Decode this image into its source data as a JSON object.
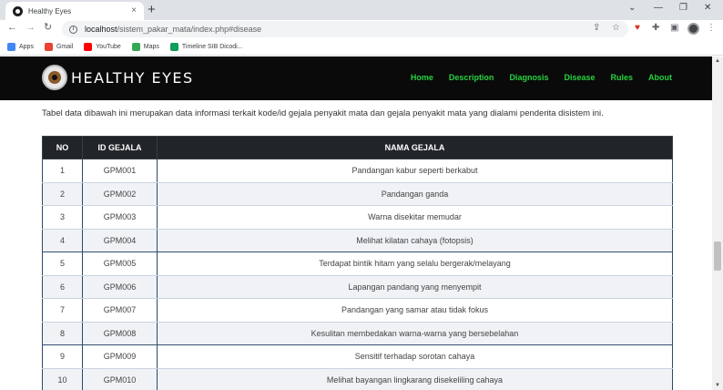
{
  "browser": {
    "tab_title": "Healthy Eyes",
    "tab_close": "×",
    "new_tab": "+",
    "window_controls": [
      "⌄",
      "—",
      "❐",
      "✕"
    ],
    "url_host": "localhost",
    "url_path": "/sistem_pakar_mata/index.php#disease",
    "bookmarks": [
      {
        "label": "Apps",
        "icon": "apps-grid-icon",
        "color": "#4285f4"
      },
      {
        "label": "Gmail",
        "icon": "gmail-icon",
        "color": "#ea4335"
      },
      {
        "label": "YouTube",
        "icon": "youtube-icon",
        "color": "#ff0000"
      },
      {
        "label": "Maps",
        "icon": "maps-pin-icon",
        "color": "#34a853"
      },
      {
        "label": "Timeline SIB Dicodi...",
        "icon": "plus-square-icon",
        "color": "#0f9d58"
      }
    ]
  },
  "navbar": {
    "brand": "HEALTHY EYES",
    "links": [
      "Home",
      "Description",
      "Diagnosis",
      "Disease",
      "Rules",
      "About"
    ],
    "link_color": "#27d23e"
  },
  "intro_text": "Tabel data dibawah ini merupakan data informasi terkait kode/id gejala penyakit mata dan gejala penyakit mata yang dialami penderita disistem ini.",
  "table": {
    "headers": [
      "NO",
      "ID GEJALA",
      "NAMA GEJALA"
    ],
    "rows": [
      [
        "1",
        "GPM001",
        "Pandangan kabur seperti berkabut"
      ],
      [
        "2",
        "GPM002",
        "Pandangan ganda"
      ],
      [
        "3",
        "GPM003",
        "Warna disekitar memudar"
      ],
      [
        "4",
        "GPM004",
        "Melihat kilatan cahaya (fotopsis)"
      ],
      [
        "5",
        "GPM005",
        "Terdapat bintik hitam yang selalu bergerak/melayang"
      ],
      [
        "6",
        "GPM006",
        "Lapangan pandang yang menyempit"
      ],
      [
        "7",
        "GPM007",
        "Pandangan yang samar atau tidak fokus"
      ],
      [
        "8",
        "GPM008",
        "Kesulitan membedakan warna-warna yang bersebelahan"
      ],
      [
        "9",
        "GPM009",
        "Sensitif terhadap sorotan cahaya"
      ],
      [
        "10",
        "GPM010",
        "Melihat bayangan lingkarang disekeliling cahaya"
      ]
    ]
  }
}
